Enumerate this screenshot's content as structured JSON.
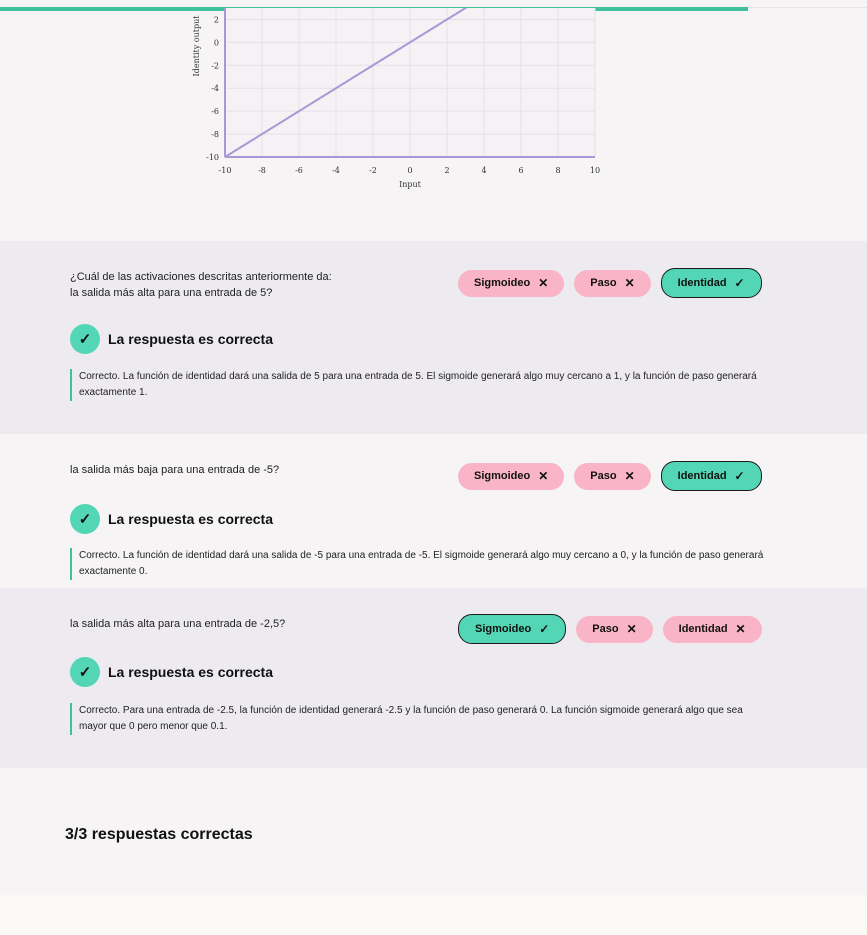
{
  "progress": {
    "value": 0.863
  },
  "chart_data": {
    "type": "line",
    "xlabel": "Input",
    "ylabel": "Identity output",
    "xlim": [
      -10,
      10
    ],
    "xticks": [
      -10,
      -8,
      -6,
      -4,
      -2,
      0,
      2,
      4,
      6,
      8,
      10
    ],
    "yticks_visible": [
      2,
      0,
      -2,
      -4,
      -6,
      -8,
      -10
    ],
    "ylim_visible": [
      -10,
      3
    ],
    "grid": true,
    "series": [
      {
        "x": [
          -10,
          3.3
        ],
        "y": [
          -10,
          3.3
        ],
        "color": "#a59ad6"
      }
    ]
  },
  "questions": [
    {
      "prompt_lines": [
        "¿Cuál de las activaciones descritas anteriormente da:",
        "la salida más alta para una entrada de 5?"
      ],
      "options": [
        {
          "label": "Sigmoideo",
          "mark": "✕",
          "selected": false
        },
        {
          "label": "Paso",
          "mark": "✕",
          "selected": false
        },
        {
          "label": "Identidad",
          "mark": "✓",
          "selected": true
        }
      ],
      "result": "La respuesta es correcta",
      "explanation": "Correcto. La función de identidad dará una salida de 5 para una entrada de 5. El sigmoide generará algo muy cercano a 1, y la función de paso generará exactamente 1."
    },
    {
      "prompt_lines": [
        "la salida más baja para una entrada de -5?"
      ],
      "options": [
        {
          "label": "Sigmoideo",
          "mark": "✕",
          "selected": false
        },
        {
          "label": "Paso",
          "mark": "✕",
          "selected": false
        },
        {
          "label": "Identidad",
          "mark": "✓",
          "selected": true
        }
      ],
      "result": "La respuesta es correcta",
      "explanation": "Correcto. La función de identidad dará una salida de -5 para una entrada de -5. El sigmoide generará algo muy cercano a 0, y la función de paso generará exactamente 0."
    },
    {
      "prompt_lines": [
        "la salida más alta para una entrada de -2,5?"
      ],
      "options": [
        {
          "label": "Sigmoideo",
          "mark": "✓",
          "selected": true
        },
        {
          "label": "Paso",
          "mark": "✕",
          "selected": false
        },
        {
          "label": "Identidad",
          "mark": "✕",
          "selected": false
        }
      ],
      "result": "La respuesta es correcta",
      "explanation": "Correcto. Para una entrada de -2.5, la función de identidad generará -2.5 y la función de paso generará 0. La función sigmoide generará algo que sea mayor que 0 pero menor que 0.1."
    }
  ],
  "score": "3/3 respuestas correctas",
  "colors": {
    "accent": "#53d6b5",
    "wrong": "#f9b5c7",
    "line": "#a59ad6"
  }
}
